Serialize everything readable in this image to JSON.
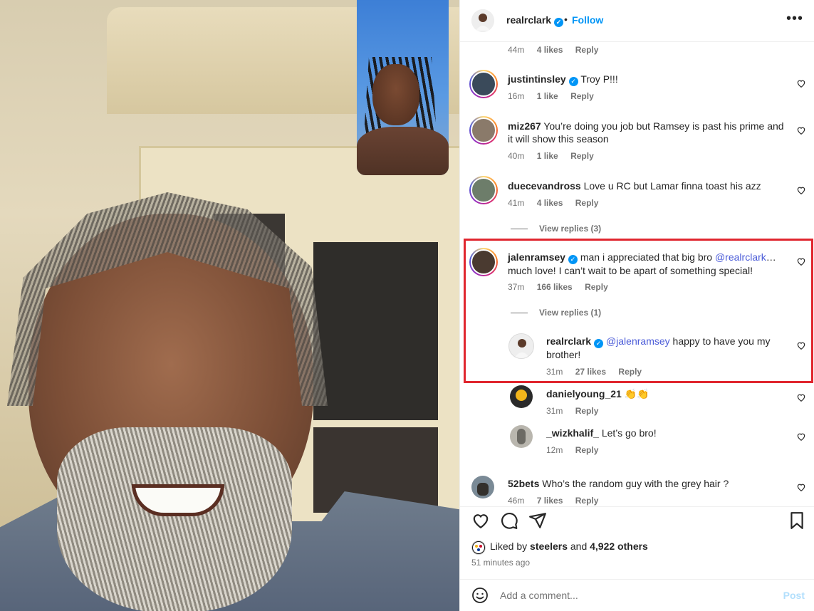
{
  "header": {
    "username": "realrclark",
    "separator": "•",
    "follow_label": "Follow",
    "more_icon": "more-horizontal-icon"
  },
  "comments": {
    "top_partial": {
      "time": "44m",
      "likes": "4 likes",
      "reply": "Reply"
    },
    "items": [
      {
        "user": "justintinsley",
        "verified": true,
        "text": "Troy P!!!",
        "time": "16m",
        "likes": "1 like",
        "reply": "Reply"
      },
      {
        "user": "miz267",
        "verified": false,
        "text": "You’re doing you job but Ramsey is past his prime and it will show this season",
        "time": "40m",
        "likes": "1 like",
        "reply": "Reply"
      },
      {
        "user": "duecevandross",
        "verified": false,
        "text": "Love u RC but Lamar finna toast his azz",
        "time": "41m",
        "likes": "4 likes",
        "reply": "Reply",
        "view_replies": "View replies (3)"
      },
      {
        "user": "jalenramsey",
        "verified": true,
        "text_pre": "man i appreciated that big bro",
        "mention": "@realrclark",
        "text_post": "… much love! I can’t wait to be apart of something special!",
        "time": "37m",
        "likes": "166 likes",
        "reply": "Reply",
        "view_replies": "View replies (1)"
      }
    ],
    "replies": [
      {
        "user": "realrclark",
        "verified": true,
        "mention": "@jalenramsey",
        "text": "happy to have you my brother!",
        "time": "31m",
        "likes": "27 likes",
        "reply": "Reply"
      },
      {
        "user": "danielyoung_21",
        "verified": false,
        "text": "👏👏",
        "time": "31m",
        "reply": "Reply"
      },
      {
        "user": "_wizkhalif_",
        "verified": false,
        "text": "Let’s go bro!",
        "time": "12m",
        "reply": "Reply"
      }
    ],
    "last": {
      "user": "52bets",
      "text": "Who’s the random guy with the grey hair ?",
      "time": "46m",
      "likes": "7 likes",
      "reply": "Reply"
    }
  },
  "footer": {
    "liked_by_prefix": "Liked by",
    "liked_by_user": "steelers",
    "liked_by_and": "and",
    "liked_by_others": "4,922 others",
    "time_ago": "51 minutes ago",
    "comment_placeholder": "Add a comment...",
    "post_label": "Post"
  },
  "colors": {
    "accent": "#0095f6",
    "highlight_border": "#e0262e",
    "mention": "#4a5bd8"
  }
}
